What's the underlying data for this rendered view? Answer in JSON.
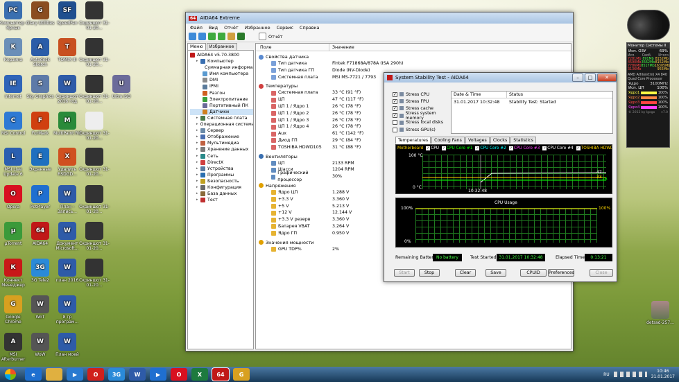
{
  "desktop": {
    "icons": [
      {
        "label": "Компьютер - Ярлык",
        "color": "#3a6fb0",
        "glyph": "PC"
      },
      {
        "label": "Glary Utilities",
        "color": "#8a4d20",
        "glyph": "G"
      },
      {
        "label": "SpeedFan",
        "color": "#1f4f8f",
        "glyph": "SF"
      },
      {
        "label": "Скриншот 31-01-20...",
        "color": "#333",
        "glyph": ""
      },
      {
        "label": "Корзина",
        "color": "#6b8fb8",
        "glyph": "K"
      },
      {
        "label": "Autodesk Sketch",
        "color": "#2a5ca8",
        "glyph": "A"
      },
      {
        "label": "TOMIX III",
        "color": "#c85020",
        "glyph": "T"
      },
      {
        "label": "Скриншот 31-01-20...",
        "color": "#333",
        "glyph": ""
      },
      {
        "label": "Internet",
        "color": "#2f64b8",
        "glyph": "IE"
      },
      {
        "label": "Sky Graphics",
        "color": "#5d7aa8",
        "glyph": "S"
      },
      {
        "label": "Скриншот 2016 год",
        "color": "#2e5ba8",
        "glyph": "W"
      },
      {
        "label": "Скриншот 31-01-20...",
        "color": "#333",
        "glyph": ""
      },
      {
        "label": "Ultra ISO",
        "color": "#6b6b9a",
        "glyph": "U"
      },
      {
        "label": "MSI Control",
        "color": "#2e7ad4",
        "glyph": "C"
      },
      {
        "label": "FurMark",
        "color": "#d04010",
        "glyph": "F"
      },
      {
        "label": "MultiPaint RU",
        "color": "#2a8a3a",
        "glyph": "M"
      },
      {
        "label": "Скриншот 31-01-20...",
        "color": "#eee",
        "glyph": ""
      },
      {
        "label": "MSI Live Update 6",
        "color": "#2a5fb0",
        "glyph": "L"
      },
      {
        "label": "Экранные",
        "color": "#1e6fbf",
        "glyph": "E"
      },
      {
        "label": "Удалить RSDGD...",
        "color": "#d05020",
        "glyph": "X"
      },
      {
        "label": "Скриншот 31-01-20...",
        "color": "#333",
        "glyph": ""
      },
      {
        "label": "Opera",
        "color": "#d81020",
        "glyph": "O"
      },
      {
        "label": "PotPlayer",
        "color": "#1f6fd0",
        "glyph": "P"
      },
      {
        "label": "План - Запись...",
        "color": "#2e5ba8",
        "glyph": "W"
      },
      {
        "label": "Скриншот 31-01-20...",
        "color": "#333",
        "glyph": ""
      },
      {
        "label": "µTorrent",
        "color": "#3a9a3a",
        "glyph": "µ"
      },
      {
        "label": "AIDA64",
        "color": "#c01818",
        "glyph": "64"
      },
      {
        "label": "Документ Microsoft...",
        "color": "#2e5ba8",
        "glyph": "W"
      },
      {
        "label": "Скриншот 31-01-20...",
        "color": "#333",
        "glyph": ""
      },
      {
        "label": "Коннект Менеджер",
        "color": "#c81818",
        "glyph": "К"
      },
      {
        "label": "3G Tele2",
        "color": "#2a8ad8",
        "glyph": "3G"
      },
      {
        "label": "план 2016",
        "color": "#2e5ba8",
        "glyph": "W"
      },
      {
        "label": "Скриншот 31-01-20...",
        "color": "#333",
        "glyph": ""
      },
      {
        "label": "Google Chrome",
        "color": "#d8a020",
        "glyph": "G"
      },
      {
        "label": "WoT",
        "color": "#555",
        "glyph": "W"
      },
      {
        "label": "8 гр програм...",
        "color": "#2e5ba8",
        "glyph": "W"
      },
      {
        "label": "MSI Afterburner",
        "color": "#333",
        "glyph": "A"
      },
      {
        "label": "WoW",
        "color": "#555",
        "glyph": "W"
      },
      {
        "label": "План моей",
        "color": "#2e5ba8",
        "glyph": "W"
      },
      {
        "label": "detsad-257...",
        "color": "#777",
        "glyph": ""
      }
    ]
  },
  "aida": {
    "title": "AIDA64 Extreme",
    "menu": [
      "Файл",
      "Вид",
      "Отчёт",
      "Избранное",
      "Сервис",
      "Справка"
    ],
    "toolbar_report": "Отчёт",
    "tabs": [
      "Меню",
      "Избранное"
    ],
    "tree": [
      {
        "label": "AIDA64 v5.70.3800",
        "level": 0
      },
      {
        "label": "Компьютер",
        "level": 1
      },
      {
        "label": "Суммарная информа...",
        "level": 2
      },
      {
        "label": "Имя компьютера",
        "level": 2
      },
      {
        "label": "DMI",
        "level": 2
      },
      {
        "label": "IPMI",
        "level": 2
      },
      {
        "label": "Разгон",
        "level": 2
      },
      {
        "label": "Электропитание",
        "level": 2
      },
      {
        "label": "Портативный ПК",
        "level": 2
      },
      {
        "label": "Датчики",
        "level": 2
      },
      {
        "label": "Системная плата",
        "level": 1
      },
      {
        "label": "Операционная система",
        "level": 1
      },
      {
        "label": "Сервер",
        "level": 1
      },
      {
        "label": "Отображение",
        "level": 1
      },
      {
        "label": "Мультимедиа",
        "level": 1
      },
      {
        "label": "Хранение данных",
        "level": 1
      },
      {
        "label": "Сеть",
        "level": 1
      },
      {
        "label": "DirectX",
        "level": 1
      },
      {
        "label": "Устройства",
        "level": 1
      },
      {
        "label": "Программы",
        "level": 1
      },
      {
        "label": "Безопасность",
        "level": 1
      },
      {
        "label": "Конфигурация",
        "level": 1
      },
      {
        "label": "База данных",
        "level": 1
      },
      {
        "label": "Тест",
        "level": 1
      }
    ],
    "col_field": "Поле",
    "col_value": "Значение",
    "groups": [
      {
        "title": "Свойства датчика",
        "rows": [
          [
            "Тип датчика",
            "Fintek F71868A/878A  (ISA 290h)"
          ],
          [
            "Тип датчика ГП",
            "Diode  (NV-Diode)"
          ],
          [
            "Системная плата",
            "MSI MS-7721 / 7793"
          ]
        ]
      },
      {
        "title": "Температуры",
        "rows": [
          [
            "Системная плата",
            "33 °C  (91 °F)"
          ],
          [
            "ЦП",
            "47 °C  (117 °F)"
          ],
          [
            "ЦП 1 / Ядро 1",
            "26 °C  (78 °F)"
          ],
          [
            "ЦП 1 / Ядро 2",
            "26 °C  (78 °F)"
          ],
          [
            "ЦП 1 / Ядро 3",
            "26 °C  (78 °F)"
          ],
          [
            "ЦП 1 / Ядро 4",
            "26 °C  (78 °F)"
          ],
          [
            "Aux",
            "61 °C  (142 °F)"
          ],
          [
            "Диод ГП",
            "29 °C  (84 °F)"
          ],
          [
            "TOSHIBA HDWD105",
            "31 °C  (88 °F)"
          ]
        ]
      },
      {
        "title": "Вентиляторы",
        "rows": [
          [
            "ЦП",
            "2133 RPM"
          ],
          [
            "Шасси",
            "1204 RPM"
          ],
          [
            "Графический процессор",
            "30%"
          ]
        ]
      },
      {
        "title": "Напряжения",
        "rows": [
          [
            "Ядро ЦП",
            "1.288 V"
          ],
          [
            "+3.3 V",
            "3.360 V"
          ],
          [
            "+5 V",
            "5.213 V"
          ],
          [
            "+12 V",
            "12.144 V"
          ],
          [
            "+3.3 V резерв",
            "3.360 V"
          ],
          [
            "Батарея VBAT",
            "3.264 V"
          ],
          [
            "Ядро ГП",
            "0.950 V"
          ]
        ]
      },
      {
        "title": "Значения мощности",
        "rows": [
          [
            "GPU TDP%",
            "2%"
          ]
        ]
      }
    ]
  },
  "sst": {
    "title": "System Stability Test - AIDA64",
    "checks": [
      {
        "label": "Stress CPU",
        "on": true
      },
      {
        "label": "Stress FPU",
        "on": true
      },
      {
        "label": "Stress cache",
        "on": true
      },
      {
        "label": "Stress system memory",
        "on": true
      },
      {
        "label": "Stress local disks",
        "on": false
      },
      {
        "label": "Stress GPU(s)",
        "on": false
      }
    ],
    "log_cols": [
      "Date & Time",
      "Status"
    ],
    "log_rows": [
      [
        "31.01.2017 10:32:48",
        "Stability Test: Started"
      ]
    ],
    "tabs": [
      "Temperatures",
      "Cooling Fans",
      "Voltages",
      "Clocks",
      "Statistics"
    ],
    "legend": [
      {
        "label": "Motherboard",
        "color": "#ffd700"
      },
      {
        "label": "CPU",
        "color": "#ffffff"
      },
      {
        "label": "CPU Core #1",
        "color": "#00ff00"
      },
      {
        "label": "CPU Core #2",
        "color": "#00ffff"
      },
      {
        "label": "CPU Core #3",
        "color": "#ff44ff"
      },
      {
        "label": "CPU Core #4",
        "color": "#ffffff"
      },
      {
        "label": "TOSHIBA HDWD10",
        "color": "#ffd700"
      }
    ],
    "temp_top": "100 °C",
    "temp_bottom": "0 °C",
    "temp_time": "10:32:48",
    "temp_vals": [
      "47",
      "33",
      "26"
    ],
    "cpu_title": "CPU Usage",
    "cpu_top": "100%",
    "cpu_bottom": "0%",
    "cpu_right_top": "100%",
    "battery_label": "Remaining Battery:",
    "battery_value": "No battery",
    "started_label": "Test Started:",
    "started_value": "31.01.2017 10:32:48",
    "elapsed_label": "Elapsed Time:",
    "elapsed_value": "0:13:21",
    "buttons": [
      "Start",
      "Stop",
      "Clear",
      "Save",
      "CPUID",
      "Preferences",
      "Close"
    ]
  },
  "gadget": {
    "title": "Монитор Системы II",
    "head": [
      "Исп. ОЗУ",
      "69%"
    ],
    "cols": [
      "Исп.",
      "Своб.",
      "Итого"
    ],
    "rows": [
      [
        "7281Mb",
        "891Mb",
        "8152Mb"
      ],
      [
        "4590Mb",
        "3562Mb",
        "8152Mb"
      ],
      [
        "7786Mb",
        "8517Mb",
        "16305Mb"
      ],
      [
        "3136Mb",
        "",
        "955Mb"
      ]
    ],
    "cpu_name": "AMD Athlon(tm) X4 840 Quad Core Processor",
    "cpu_head": [
      "Ядро",
      "3100MHz"
    ],
    "cpu_use": [
      "Исп. ЦП",
      "100%"
    ],
    "cores": [
      [
        "Ядро1",
        "100%"
      ],
      [
        "Ядро2",
        "100%"
      ],
      [
        "Ядро3",
        "100%"
      ],
      [
        "Ядро4",
        "100%"
      ]
    ],
    "footer": "© 2012 by Igogo",
    "ver": "v7.0"
  },
  "tray": {
    "lang": "RU",
    "time": "10:46",
    "date": "31.01.2017"
  },
  "taskbar": {
    "items": [
      {
        "g": "e",
        "c": "#1e6fd0"
      },
      {
        "g": "",
        "c": "#e0b040"
      },
      {
        "g": "▶",
        "c": "#2a7ad0"
      },
      {
        "g": "O",
        "c": "#d0201c"
      },
      {
        "g": "3G",
        "c": "#2a8ad8"
      },
      {
        "g": "W",
        "c": "#2e5ba8"
      },
      {
        "g": "▶",
        "c": "#1f6fd0"
      },
      {
        "g": "O",
        "c": "#d81020"
      },
      {
        "g": "X",
        "c": "#1d7a3e"
      },
      {
        "g": "64",
        "c": "#c01818"
      },
      {
        "g": "G",
        "c": "#d8a020"
      }
    ]
  }
}
